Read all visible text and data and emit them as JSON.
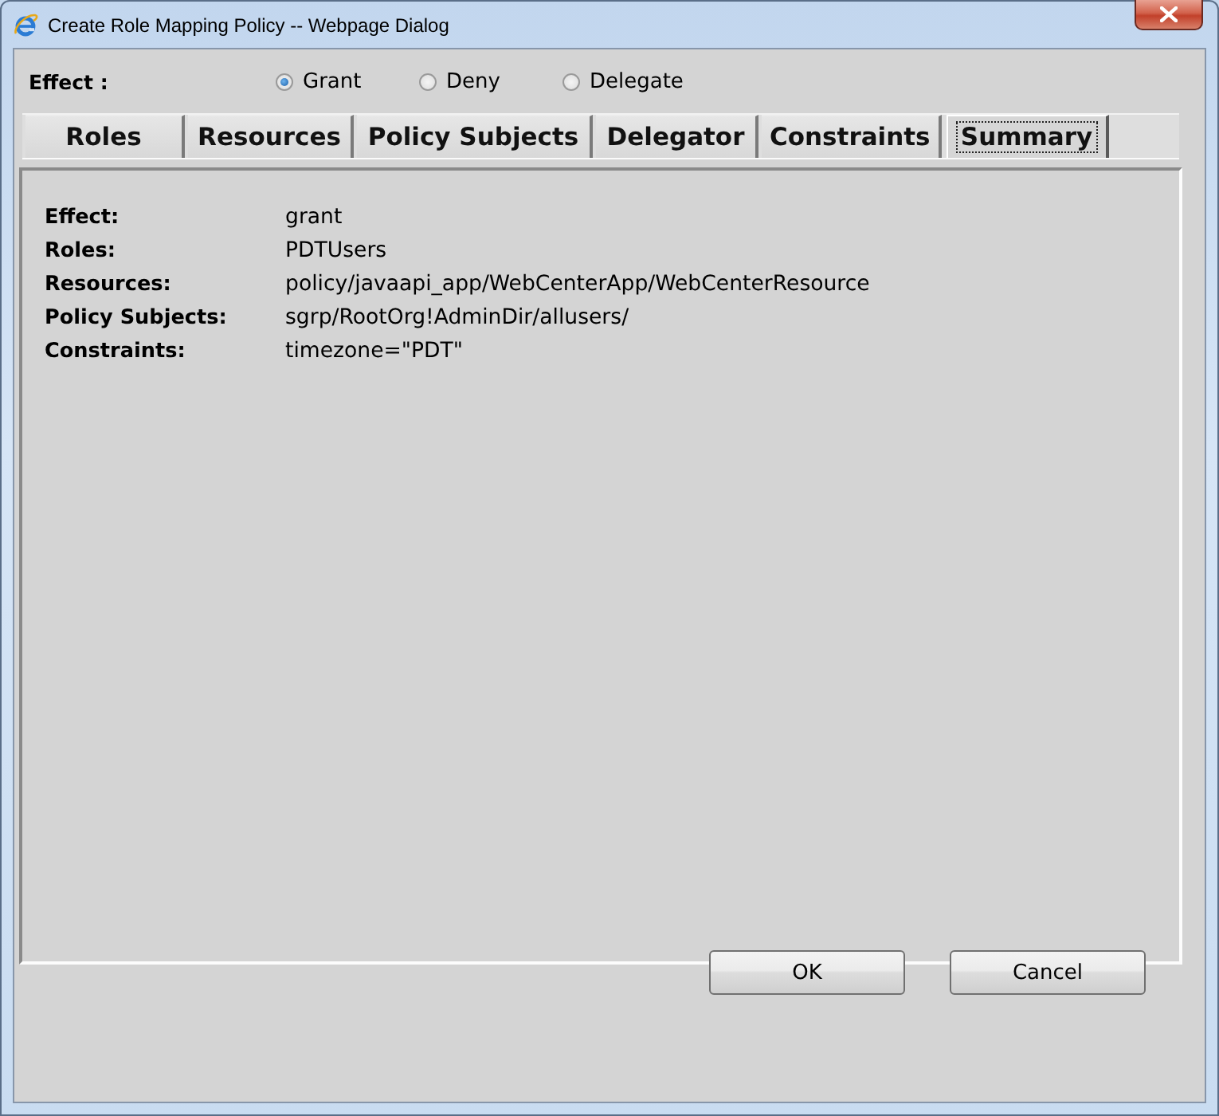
{
  "window": {
    "title": "Create Role Mapping Policy -- Webpage Dialog"
  },
  "effect": {
    "label": "Effect :",
    "options": [
      {
        "label": "Grant",
        "selected": true
      },
      {
        "label": "Deny",
        "selected": false
      },
      {
        "label": "Delegate",
        "selected": false
      }
    ]
  },
  "tabs": [
    {
      "label": "Roles",
      "selected": false
    },
    {
      "label": "Resources",
      "selected": false
    },
    {
      "label": "Policy Subjects",
      "selected": false
    },
    {
      "label": "Delegator",
      "selected": false
    },
    {
      "label": "Constraints",
      "selected": false
    },
    {
      "label": "Summary",
      "selected": true
    }
  ],
  "summary": {
    "rows": [
      {
        "label": "Effect:",
        "value": "grant"
      },
      {
        "label": "Roles:",
        "value": "PDTUsers"
      },
      {
        "label": "Resources:",
        "value": "policy/javaapi_app/WebCenterApp/WebCenterResource"
      },
      {
        "label": "Policy Subjects:",
        "value": "sgrp/RootOrg!AdminDir/allusers/"
      },
      {
        "label": "Constraints:",
        "value": "timezone=\"PDT\""
      }
    ]
  },
  "buttons": [
    {
      "label": "OK"
    },
    {
      "label": "Cancel"
    }
  ]
}
